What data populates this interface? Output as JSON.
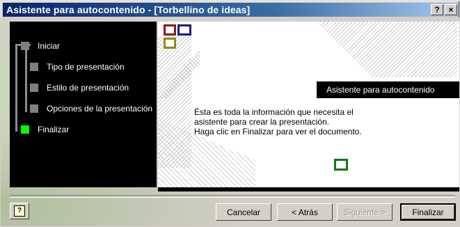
{
  "window": {
    "title": "Asistente para autocontenido - [Torbellino de ideas]",
    "help_glyph": "?",
    "close_glyph": "×"
  },
  "steps": [
    {
      "label": "Iniciar",
      "state": "done"
    },
    {
      "label": "Tipo de presentación",
      "state": "done"
    },
    {
      "label": "Estilo de presentación",
      "state": "done"
    },
    {
      "label": "Opciones de la presentación",
      "state": "done"
    },
    {
      "label": "Finalizar",
      "state": "active"
    }
  ],
  "content": {
    "banner": "Asistente para autocontenido",
    "message_lines": [
      "Ésta es toda la información que necesita el",
      "asistente para crear la presentación.",
      "Haga clic en Finalizar para ver el documento."
    ]
  },
  "buttons": {
    "help_icon_glyph": "?",
    "cancel": "Cancelar",
    "back": "< Atrás",
    "next": "Siguiente >",
    "finish": "Finalizar"
  },
  "colors": {
    "titlebar_start": "#0a246a",
    "titlebar_end": "#a6caf0",
    "step_active": "#00ff00",
    "step_inactive": "#808080",
    "deco_red": "#8b1a1a",
    "deco_blue": "#1a1a8c",
    "deco_olive": "#8c8c1a",
    "deco_green": "#0f7a0f"
  }
}
